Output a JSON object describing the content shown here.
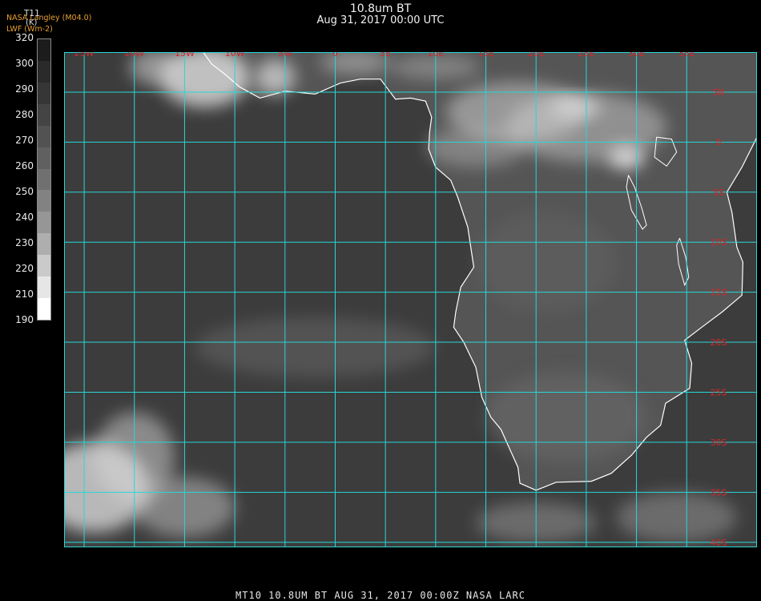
{
  "header": {
    "title": "10.8um BT",
    "subtitle": "Aug 31, 2017 00:00 UTC"
  },
  "credit": {
    "line1": "NASA Langley (M04.0)",
    "line2": "LWF (Wm-2)"
  },
  "colorbar": {
    "title": "T11",
    "unit": "(K)",
    "labels": [
      "320",
      "300",
      "290",
      "280",
      "270",
      "260",
      "250",
      "240",
      "230",
      "220",
      "210",
      "190"
    ],
    "colors": [
      "#1c1c1c",
      "#2a2a2a",
      "#363636",
      "#444444",
      "#525252",
      "#606060",
      "#707070",
      "#828282",
      "#969696",
      "#aeaeae",
      "#cacaca",
      "#e6e6e6",
      "#ffffff"
    ]
  },
  "map": {
    "lon_range": [
      -27,
      42
    ],
    "lat_range": [
      9,
      -40.5
    ],
    "lon_ticks": [
      {
        "value": -25,
        "label": "25W"
      },
      {
        "value": -20,
        "label": "20W"
      },
      {
        "value": -15,
        "label": "15W"
      },
      {
        "value": -10,
        "label": "10W"
      },
      {
        "value": -5,
        "label": "5W"
      },
      {
        "value": 0,
        "label": "0"
      },
      {
        "value": 5,
        "label": "5E"
      },
      {
        "value": 10,
        "label": "10E"
      },
      {
        "value": 15,
        "label": "15E"
      },
      {
        "value": 20,
        "label": "20E"
      },
      {
        "value": 25,
        "label": "25E"
      },
      {
        "value": 30,
        "label": "30E"
      },
      {
        "value": 35,
        "label": "35E"
      }
    ],
    "lat_ticks": [
      {
        "value": 5,
        "label": "5N"
      },
      {
        "value": 0,
        "label": "0"
      },
      {
        "value": -5,
        "label": "5S"
      },
      {
        "value": -10,
        "label": "10S"
      },
      {
        "value": -15,
        "label": "15S"
      },
      {
        "value": -20,
        "label": "20S"
      },
      {
        "value": -25,
        "label": "25S"
      },
      {
        "value": -30,
        "label": "30S"
      },
      {
        "value": -35,
        "label": "35S"
      },
      {
        "value": -40,
        "label": "40S"
      }
    ],
    "grid_color": "#29d6d6",
    "label_color": "#d8262a",
    "coast_color": "#ffffff",
    "background_color": "#3c3c3c",
    "land_color": "#555555",
    "cloud_color": "#d8d8d8",
    "coastline": [
      [
        -17.5,
        14.7
      ],
      [
        -16.8,
        12.5
      ],
      [
        -15.2,
        11.0
      ],
      [
        -13.5,
        9.5
      ],
      [
        -12.3,
        7.8
      ],
      [
        -11.0,
        6.8
      ],
      [
        -9.5,
        5.5
      ],
      [
        -7.5,
        4.4
      ],
      [
        -5.0,
        5.1
      ],
      [
        -2.0,
        4.8
      ],
      [
        0.5,
        5.9
      ],
      [
        2.5,
        6.3
      ],
      [
        4.5,
        6.3
      ],
      [
        6.0,
        4.3
      ],
      [
        7.5,
        4.4
      ],
      [
        9.0,
        4.1
      ],
      [
        9.6,
        2.5
      ],
      [
        9.4,
        1.0
      ],
      [
        9.3,
        -0.7
      ],
      [
        10.0,
        -2.5
      ],
      [
        11.5,
        -3.8
      ],
      [
        12.2,
        -5.5
      ],
      [
        13.2,
        -8.5
      ],
      [
        13.5,
        -10.5
      ],
      [
        13.8,
        -12.5
      ],
      [
        12.5,
        -14.5
      ],
      [
        12.0,
        -17.0
      ],
      [
        11.8,
        -18.5
      ],
      [
        12.8,
        -20.0
      ],
      [
        14.0,
        -22.5
      ],
      [
        14.6,
        -25.5
      ],
      [
        15.5,
        -27.5
      ],
      [
        16.5,
        -28.7
      ],
      [
        17.3,
        -30.5
      ],
      [
        18.2,
        -32.5
      ],
      [
        18.4,
        -34.1
      ],
      [
        20.0,
        -34.8
      ],
      [
        22.0,
        -34.0
      ],
      [
        25.5,
        -33.9
      ],
      [
        27.5,
        -33.1
      ],
      [
        29.5,
        -31.3
      ],
      [
        31.0,
        -29.5
      ],
      [
        32.4,
        -28.3
      ],
      [
        32.9,
        -26.1
      ],
      [
        35.3,
        -24.6
      ],
      [
        35.5,
        -22.1
      ],
      [
        34.8,
        -19.8
      ],
      [
        36.5,
        -18.5
      ],
      [
        38.5,
        -17.0
      ],
      [
        40.5,
        -15.3
      ],
      [
        40.6,
        -12.0
      ],
      [
        40.0,
        -10.5
      ],
      [
        39.5,
        -7.0
      ],
      [
        39.0,
        -5.0
      ],
      [
        40.5,
        -2.5
      ],
      [
        42.0,
        0.5
      ]
    ],
    "lakes": [
      [
        [
          32.0,
          0.5
        ],
        [
          33.5,
          0.3
        ],
        [
          34.0,
          -1.0
        ],
        [
          33.0,
          -2.4
        ],
        [
          31.8,
          -1.5
        ],
        [
          32.0,
          0.5
        ]
      ],
      [
        [
          29.2,
          -3.3
        ],
        [
          29.8,
          -4.5
        ],
        [
          30.5,
          -6.5
        ],
        [
          31.0,
          -8.3
        ],
        [
          30.6,
          -8.7
        ],
        [
          29.5,
          -6.8
        ],
        [
          29.0,
          -4.5
        ],
        [
          29.2,
          -3.3
        ]
      ],
      [
        [
          34.3,
          -9.6
        ],
        [
          34.9,
          -11.5
        ],
        [
          35.2,
          -13.5
        ],
        [
          34.8,
          -14.3
        ],
        [
          34.2,
          -12.2
        ],
        [
          34.0,
          -10.3
        ],
        [
          34.3,
          -9.6
        ]
      ]
    ],
    "clouds": [
      {
        "lon": -13,
        "lat": 6.5,
        "rx": 4.5,
        "ry": 3.0,
        "o": 0.85
      },
      {
        "lon": -18,
        "lat": 7.5,
        "rx": 2.5,
        "ry": 1.8,
        "o": 0.55
      },
      {
        "lon": -6,
        "lat": 6.5,
        "rx": 2.0,
        "ry": 1.8,
        "o": 0.75
      },
      {
        "lon": 2,
        "lat": 8.0,
        "rx": 3.5,
        "ry": 1.2,
        "o": 0.45
      },
      {
        "lon": 10,
        "lat": 7.5,
        "rx": 4.5,
        "ry": 1.2,
        "o": 0.35
      },
      {
        "lon": 18,
        "lat": 3.0,
        "rx": 7.0,
        "ry": 3.0,
        "o": 0.5
      },
      {
        "lon": 25,
        "lat": 1.5,
        "rx": 8.0,
        "ry": 3.5,
        "o": 0.45
      },
      {
        "lon": 24,
        "lat": 3.5,
        "rx": 2.5,
        "ry": 1.0,
        "o": 0.8
      },
      {
        "lon": 29,
        "lat": -1.5,
        "rx": 1.8,
        "ry": 1.2,
        "o": 0.95
      },
      {
        "lon": 14,
        "lat": -0.5,
        "rx": 5.0,
        "ry": 2.0,
        "o": 0.35
      },
      {
        "lon": -24,
        "lat": -34.5,
        "rx": 5.5,
        "ry": 4.5,
        "o": 0.8
      },
      {
        "lon": -20,
        "lat": -31.5,
        "rx": 4.0,
        "ry": 4.5,
        "o": 0.5
      },
      {
        "lon": -15,
        "lat": -36.5,
        "rx": 5.0,
        "ry": 3.0,
        "o": 0.45
      },
      {
        "lon": 20,
        "lat": -38.0,
        "rx": 6.0,
        "ry": 2.0,
        "o": 0.3
      },
      {
        "lon": 34,
        "lat": -37.5,
        "rx": 6.0,
        "ry": 2.5,
        "o": 0.3
      },
      {
        "lon": -2,
        "lat": -20.5,
        "rx": 12.0,
        "ry": 3.0,
        "o": 0.15
      }
    ],
    "land_patches": [
      {
        "lon": 23,
        "lat": -27.5,
        "rx": 8.0,
        "ry": 4.5,
        "o": 0.6
      },
      {
        "lon": 21,
        "lat": -12.0,
        "rx": 7.0,
        "ry": 5.0,
        "o": 0.35
      }
    ]
  },
  "footer": {
    "text": "MT10   10.8UM BT    AUG 31, 2017 00:00Z    NASA LARC"
  }
}
